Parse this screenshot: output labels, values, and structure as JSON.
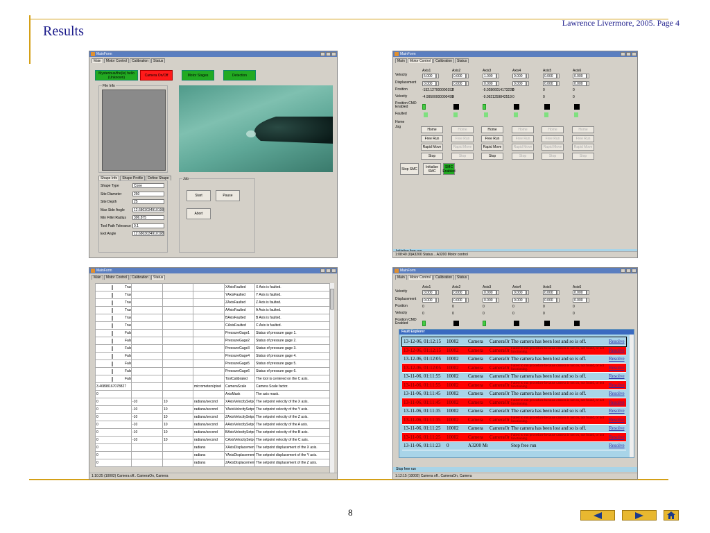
{
  "slide": {
    "title": "Results",
    "credit": "Lawrence Livermore, 2005. Page 4",
    "page_number": "8"
  },
  "nav": {
    "prev_icon": "triangle-left-icon",
    "next_icon": "triangle-right-icon",
    "home_icon": "home-icon"
  },
  "colors": {
    "gold": "#d4a017",
    "slide_text": "#1a1a8a",
    "green": "#22aa22",
    "red": "#ff0000"
  },
  "w1": {
    "title": "MainForm",
    "tabs": [
      "Main",
      "Motor Control",
      "Calibration",
      "Status"
    ],
    "buttons": [
      "Mysterious/the(le) hello (Unknown)",
      "Camera On/Off",
      "Motor Stages",
      "Detection"
    ],
    "file_info": "File Info",
    "shape_tabs": [
      "Shape Info",
      "Shape Profile",
      "Define Shape"
    ],
    "fields": [
      {
        "label": "Shape Type",
        "value": "Cone"
      },
      {
        "label": "Site Diameter",
        "value": "250"
      },
      {
        "label": "Site Depth",
        "value": "25"
      },
      {
        "label": "Max Side Angle",
        "value": "12.6803034910198"
      },
      {
        "label": "Min Fillet Radius",
        "value": "396.875"
      },
      {
        "label": "Tool Path Tolerance",
        "value": "0.1"
      },
      {
        "label": "Exit Angle",
        "value": "12.6803034910198"
      }
    ],
    "job": "Job",
    "start": "Start",
    "pause": "Pause",
    "abort": "Abort"
  },
  "w2": {
    "title": "MainForm",
    "tabs": [
      "Main",
      "Motor Control",
      "Calibration",
      "Status"
    ],
    "axes": [
      "Axis1",
      "Axis2",
      "Axis3",
      "Axis4",
      "Axis5",
      "Axis6"
    ],
    "row_labels": [
      "Velocity",
      "Displacement",
      "Position",
      "Velocity",
      "Position CMD Enabled",
      "Faulted",
      "Home",
      "Jog"
    ],
    "velocity": [
      "5.000",
      "0.000",
      "1.000",
      "0.000",
      "0.000",
      "0.000"
    ],
    "displacement": [
      "0.000",
      "0.000",
      "0.000",
      "0.000",
      "0.000",
      "0.000"
    ],
    "position": [
      "-152.127000000152",
      "0",
      "-9.02866014173228",
      "0",
      "0",
      "0"
    ],
    "velocity2": [
      "-4.99500000000499",
      "0",
      "-9.0921259842519",
      "0",
      "0",
      "0"
    ],
    "home": "Home",
    "free_run": "Free Run",
    "rapid_move": "Rapid Move",
    "stop": "Stop",
    "stop_smc": "Stop SMC",
    "init_smc": "Initialize SMC",
    "smc_enabled": "SMC Enabled",
    "status_line": "Initiating free run",
    "statusbar": "1:08:40 (0)A3200 Status....A3200 Motor control"
  },
  "w3": {
    "title": "MainForm",
    "tabs": [
      "Main",
      "Motor Control",
      "Calibration",
      "Status"
    ],
    "rows": [
      [
        "True",
        "",
        "",
        "",
        "XAxisFaulted",
        "X Axis is faulted."
      ],
      [
        "True",
        "",
        "",
        "",
        "YAxisFaulted",
        "Y Axis is faulted."
      ],
      [
        "True",
        "",
        "",
        "",
        "ZAxisFaulted",
        "Z Axis is faulted."
      ],
      [
        "True",
        "",
        "",
        "",
        "AAxisFaulted",
        "A Axis is faulted."
      ],
      [
        "True",
        "",
        "",
        "",
        "BAxisFaulted",
        "B Axis is faulted."
      ],
      [
        "True",
        "",
        "",
        "",
        "CAxisFaulted",
        "C Axis is faulted."
      ],
      [
        "False",
        "",
        "",
        "",
        "PressureGage1",
        "Status of pressure gage 1."
      ],
      [
        "False",
        "",
        "",
        "",
        "PressureGage2",
        "Status of pressure gage 2."
      ],
      [
        "False",
        "",
        "",
        "",
        "PressureGage3",
        "Status of pressure gage 3."
      ],
      [
        "False",
        "",
        "",
        "",
        "PressureGage4",
        "Status of pressure gage 4."
      ],
      [
        "False",
        "",
        "",
        "",
        "PressureGage5",
        "Status of pressure gage 5."
      ],
      [
        "False",
        "",
        "",
        "",
        "PressureGage6",
        "Status of pressure gage 6."
      ],
      [
        "False",
        "",
        "",
        "",
        "ToolCalibrated",
        "The tool is centered on the C axis."
      ],
      [
        "3.46898167078827",
        "",
        "",
        "micrometers/pixel",
        "CameraScale",
        "Camera Scale factor."
      ],
      [
        "0",
        "",
        "",
        "",
        "AxisMask",
        "The axis mask."
      ],
      [
        "0",
        "-10",
        "10",
        "radians/second",
        "XAxisVelocitySetpoint",
        "The setpoint velocity of the X axis."
      ],
      [
        "0",
        "-10",
        "10",
        "radians/second",
        "YAxisVelocitySetpoint",
        "The setpoint velocity of the Y axis."
      ],
      [
        "0",
        "-10",
        "10",
        "radians/second",
        "ZAxisVelocitySetpoint",
        "The setpoint velocity of the Z axis."
      ],
      [
        "0",
        "-10",
        "10",
        "radians/second",
        "AAxisVelocitySetpoint",
        "The setpoint velocity of the A axis."
      ],
      [
        "0",
        "-10",
        "10",
        "radians/second",
        "BAxisVelocitySetpoint",
        "The setpoint velocity of the B axis."
      ],
      [
        "0",
        "-10",
        "10",
        "radians/second",
        "CAxisVelocitySetpoint",
        "The setpoint velocity of the C axis."
      ],
      [
        "0",
        "",
        "",
        "radians",
        "XAxisDisplacementSetpoint",
        "The setpoint displacement of the X axis."
      ],
      [
        "0",
        "",
        "",
        "radians",
        "YAxisDisplacementSetpoint",
        "The setpoint displacement of the Y axis."
      ],
      [
        "0",
        "",
        "",
        "radians",
        "ZAxisDisplacementSetpoint",
        "The setpoint displacement of the Z axis."
      ]
    ],
    "statusbar": "1:10:25 (10002) Camera off.. CameraOn, Camera"
  },
  "w4": {
    "title": "MainForm",
    "tabs": [
      "Main",
      "Motor Control",
      "Calibration",
      "Status"
    ],
    "axes": [
      "Axis1",
      "Axis2",
      "Axis3",
      "Axis4",
      "Axis5",
      "Axis6"
    ],
    "row_labels": [
      "Velocity",
      "Displacement",
      "Position",
      "Velocity",
      "Position CMD Enabled"
    ],
    "vals": [
      "0.000",
      "0.000",
      "0.000",
      "0.000",
      "0.000",
      "0.000"
    ],
    "zeros": [
      "0",
      "0",
      "0",
      "0",
      "0",
      "0"
    ],
    "fe_title": "Fault Explorer",
    "faults": [
      {
        "t": "13-12-06, 01:12:15",
        "code": "10002",
        "src": "Camera",
        "id": "CameraOn",
        "msg": "The camera has been lost and so is off.",
        "act": "Resolve",
        "red": false
      },
      {
        "t": "13-12-06, 01:12:15",
        "code": "10002",
        "src": "Camera",
        "id": "CameraOn",
        "msg": "Failed to run procedure because camera is not on, not found, or not functioning.",
        "act": "Resolve",
        "red": true
      },
      {
        "t": "13-12-06, 01:12:05",
        "code": "10002",
        "src": "Camera",
        "id": "CameraOn",
        "msg": "The camera has been lost and so is off.",
        "act": "Resolve",
        "red": false
      },
      {
        "t": "13-12-06, 01:12:05",
        "code": "10002",
        "src": "Camera",
        "id": "CameraOn",
        "msg": "Failed to run procedure because camera is not on, not found, or not functioning.",
        "act": "Resolve",
        "red": true
      },
      {
        "t": "13-11-06, 01:11:55",
        "code": "10002",
        "src": "Camera",
        "id": "CameraOn",
        "msg": "The camera has been lost and so is off.",
        "act": "Resolve",
        "red": false
      },
      {
        "t": "13-11-06, 01:11:55",
        "code": "10002",
        "src": "Camera",
        "id": "CameraOn",
        "msg": "Failed to run procedure because camera is not on, not found, or not functioning.",
        "act": "Resolve",
        "red": true
      },
      {
        "t": "13-11-06, 01:11:45",
        "code": "10002",
        "src": "Camera",
        "id": "CameraOn",
        "msg": "The camera has been lost and so is off.",
        "act": "Resolve",
        "red": false
      },
      {
        "t": "13-11-06, 01:11:45",
        "code": "10002",
        "src": "Camera",
        "id": "CameraOn",
        "msg": "Failed to run procedure because camera is not on, not found, or not functioning.",
        "act": "Resolve",
        "red": true
      },
      {
        "t": "13-11-06, 01:11:35",
        "code": "10002",
        "src": "Camera",
        "id": "CameraOn",
        "msg": "The camera has been lost and so is off.",
        "act": "Resolve",
        "red": false
      },
      {
        "t": "13-11-06, 01:11:35",
        "code": "10002",
        "src": "Camera",
        "id": "CameraOn",
        "msg": "Failed to run procedure because camera is not on, not found, or not functioning.",
        "act": "Resolve",
        "red": true
      },
      {
        "t": "13-11-06, 01:11:25",
        "code": "10002",
        "src": "Camera",
        "id": "CameraOn",
        "msg": "The camera has been lost and so is off.",
        "act": "Resolve",
        "red": false
      },
      {
        "t": "13-11-06, 01:11:25",
        "code": "10002",
        "src": "Camera",
        "id": "CameraOn",
        "msg": "Failed to run procedure because camera is not on, not found, or not functioning.",
        "act": "Resolve",
        "red": true
      },
      {
        "t": "13-11-06, 01:11:23",
        "code": "0",
        "src": "A3200 Motor",
        "id": "",
        "msg": "Stop free run",
        "act": "Resolve",
        "red": false
      }
    ],
    "status_line": "Stop free run",
    "statusbar": "1:12:15 (10002) Camera off.. CameraOn, Camera"
  }
}
